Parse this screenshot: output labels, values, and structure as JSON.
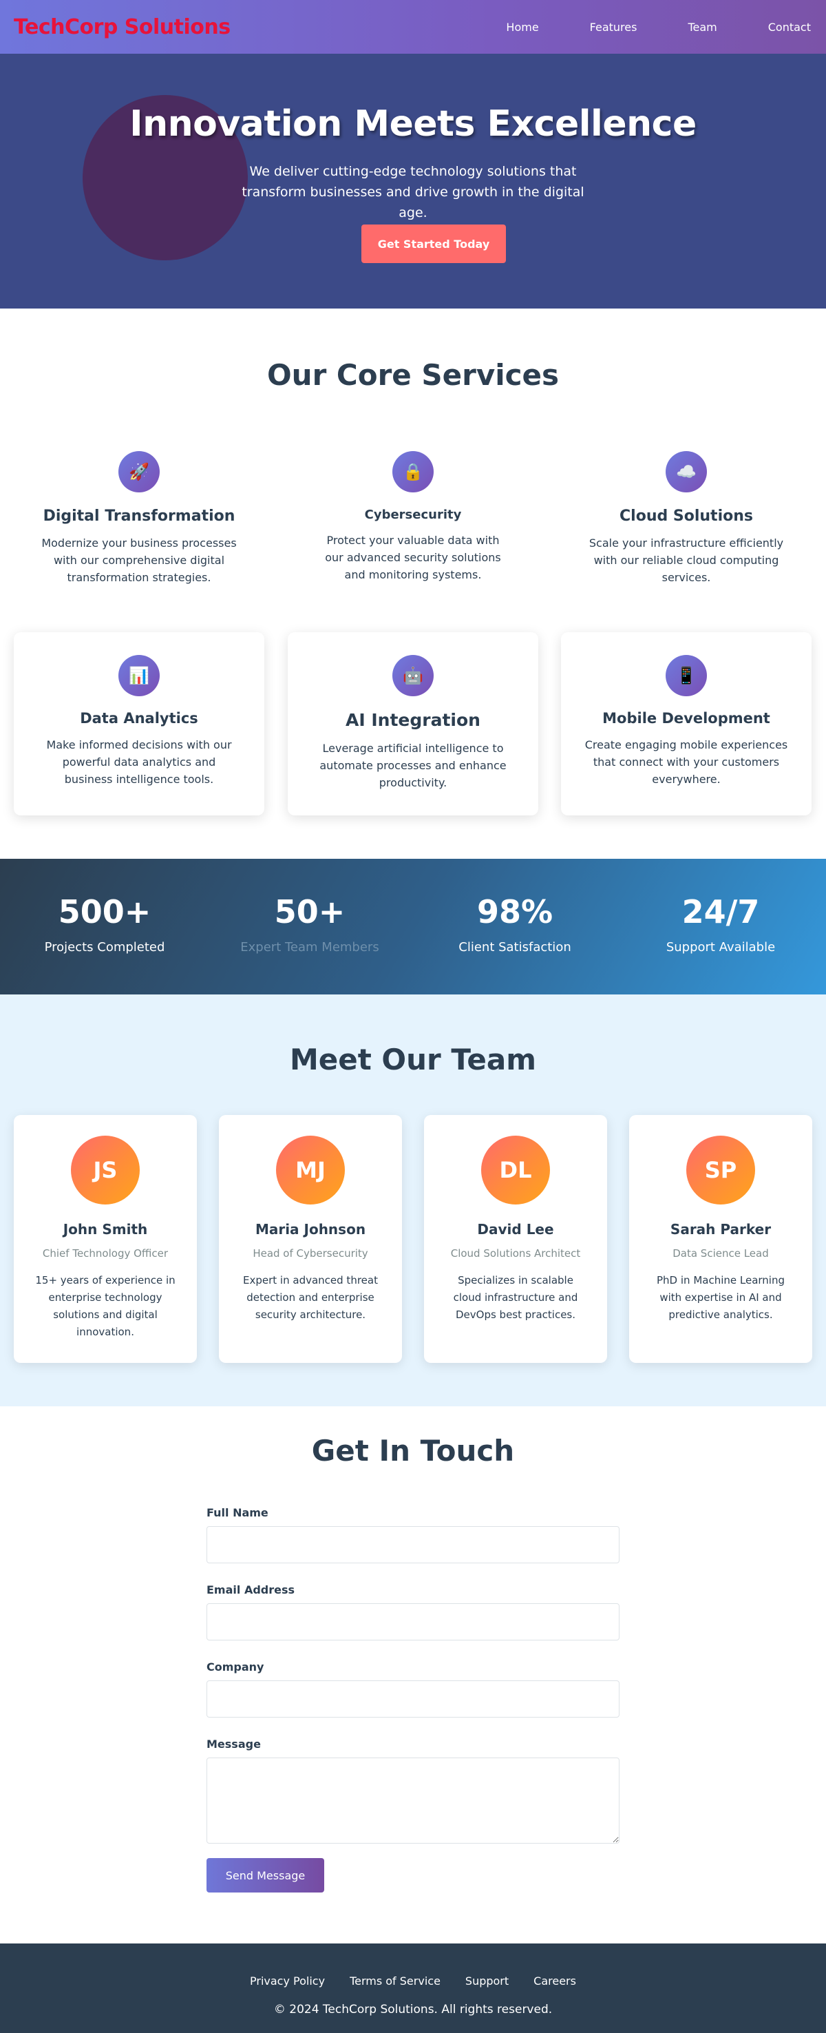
{
  "nav": {
    "logo": "TechCorp Solutions",
    "links": [
      "Home",
      "Features",
      "Team",
      "Contact"
    ]
  },
  "hero": {
    "title": "Innovation Meets Excellence",
    "subtitle": "We deliver cutting-edge technology solutions that transform businesses and drive growth in the digital age.",
    "cta": "Get Started Today"
  },
  "services": {
    "title": "Our Core Services",
    "items": [
      {
        "icon": "🚀",
        "icon_name": "rocket-icon",
        "title": "Digital Transformation",
        "desc": "Modernize your business processes with our comprehensive digital transformation strategies."
      },
      {
        "icon": "🔒",
        "icon_name": "lock-icon",
        "title": "Cybersecurity",
        "desc": "Protect your valuable data with our advanced security solutions and monitoring systems."
      },
      {
        "icon": "☁️",
        "icon_name": "cloud-icon",
        "title": "Cloud Solutions",
        "desc": "Scale your infrastructure efficiently with our reliable cloud computing services."
      },
      {
        "icon": "📊",
        "icon_name": "chart-icon",
        "title": "Data Analytics",
        "desc": "Make informed decisions with our powerful data analytics and business intelligence tools."
      },
      {
        "icon": "🤖",
        "icon_name": "robot-icon",
        "title": "AI Integration",
        "desc": "Leverage artificial intelligence to automate processes and enhance productivity."
      },
      {
        "icon": "📱",
        "icon_name": "mobile-icon",
        "title": "Mobile Development",
        "desc": "Create engaging mobile experiences that connect with your customers everywhere."
      }
    ]
  },
  "stats": [
    {
      "value": "500+",
      "label": "Projects Completed"
    },
    {
      "value": "50+",
      "label": "Expert Team Members"
    },
    {
      "value": "98%",
      "label": "Client Satisfaction"
    },
    {
      "value": "24/7",
      "label": "Support Available"
    }
  ],
  "team": {
    "title": "Meet Our Team",
    "members": [
      {
        "initials": "JS",
        "name": "John Smith",
        "role": "Chief Technology Officer",
        "bio": "15+ years of experience in enterprise technology solutions and digital innovation."
      },
      {
        "initials": "MJ",
        "name": "Maria Johnson",
        "role": "Head of Cybersecurity",
        "bio": "Expert in advanced threat detection and enterprise security architecture."
      },
      {
        "initials": "DL",
        "name": "David Lee",
        "role": "Cloud Solutions Architect",
        "bio": "Specializes in scalable cloud infrastructure and DevOps best practices."
      },
      {
        "initials": "SP",
        "name": "Sarah Parker",
        "role": "Data Science Lead",
        "bio": "PhD in Machine Learning with expertise in AI and predictive analytics."
      }
    ]
  },
  "contact": {
    "title": "Get In Touch",
    "fields": {
      "full_name": "Full Name",
      "email": "Email Address",
      "company": "Company",
      "message": "Message"
    },
    "submit": "Send Message"
  },
  "footer": {
    "links": [
      "Privacy Policy",
      "Terms of Service",
      "Support",
      "Careers"
    ],
    "copyright": "© 2024 TechCorp Solutions. All rights reserved."
  },
  "colors": {
    "primary": "#667eea",
    "secondary": "#764ba2",
    "accent": "#ff6b6b",
    "logo": "#e7133a",
    "dark": "#2c3e50"
  }
}
